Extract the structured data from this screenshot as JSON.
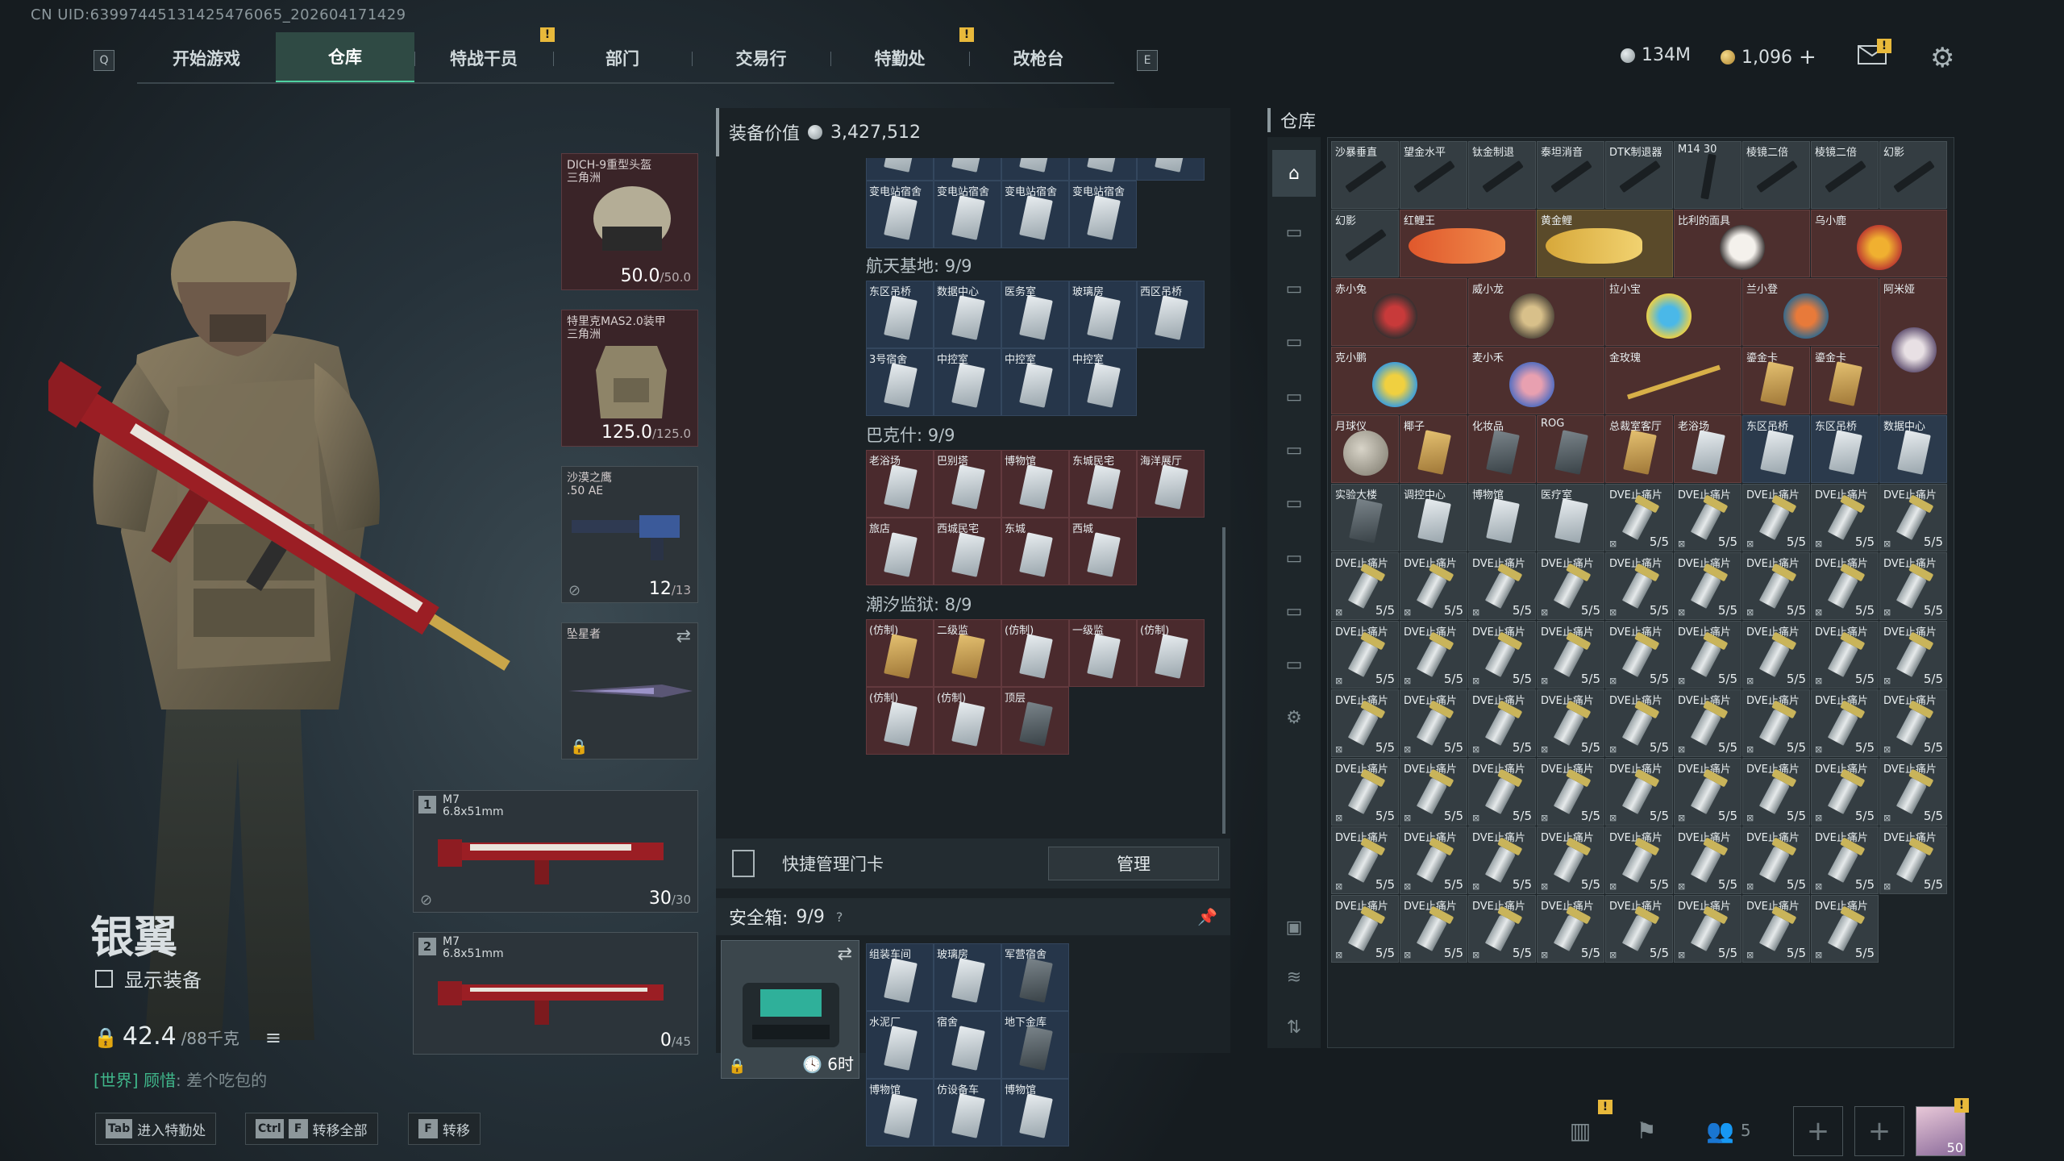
{
  "uid": "CN UID:63997445131425476065_202604171429",
  "nav": {
    "left_key": "Q",
    "right_key": "E",
    "tabs": [
      "开始游戏",
      "仓库",
      "特战干员",
      "部门",
      "交易行",
      "特勤处",
      "改枪台"
    ],
    "active": "仓库",
    "alert_mark": "!"
  },
  "currency": {
    "silver": "134M",
    "gold": "1,096",
    "plus": "+"
  },
  "character": {
    "name": "银翼",
    "show_equipment": "显示装备",
    "weight": "42.4",
    "weight_max": "/88千克",
    "chat_tag": "[世界]",
    "chat_user": "顾惜",
    "chat_msg": "差个吃包的"
  },
  "equipment": {
    "helmet": {
      "name": "DICH-9重型头盔",
      "sub": "三角洲",
      "dur": "50.0",
      "dur_max": "/50.0"
    },
    "armor": {
      "name": "特里克MAS2.0装甲",
      "sub": "三角洲",
      "dur": "125.0",
      "dur_max": "/125.0"
    },
    "pistol": {
      "name": "沙漠之鹰",
      "sub": ".50 AE",
      "ammo": "12",
      "ammo_max": "/13"
    },
    "melee": {
      "name": "坠星者"
    },
    "primary1": {
      "num": "1",
      "name": "M7",
      "caliber": "6.8x51mm",
      "ammo": "30",
      "ammo_max": "/30"
    },
    "primary2": {
      "num": "2",
      "name": "M7",
      "caliber": "6.8x51mm",
      "ammo": "0",
      "ammo_max": "/45"
    }
  },
  "middle": {
    "equip_value_label": "装备价值",
    "equip_value": "3,427,512",
    "sections": [
      {
        "title": "航天基地: 9/9",
        "items": [
          "东区吊桥",
          "数据中心",
          "医务室",
          "玻璃房",
          "西区吊桥",
          "3号宿舍",
          "中控室",
          "中控室",
          "中控室"
        ]
      },
      {
        "title": "巴克什: 9/9",
        "items": [
          "老浴场",
          "巴别塔",
          "博物馆",
          "东城民宅",
          "海洋展厅",
          "旅店",
          "西城民宅",
          "东城",
          "西城"
        ]
      },
      {
        "title": "潮汐监狱: 8/9",
        "items": [
          "(仿制)",
          "二级监",
          "(仿制)",
          "一级监",
          "(仿制)",
          "(仿制)",
          "(仿制)",
          "顶层"
        ]
      }
    ],
    "top_items": [
      "变电站宿舍",
      "变电站宿舍",
      "变电站宿舍",
      "变电站宿舍"
    ],
    "quick_manage": "快捷管理门卡",
    "manage_btn": "管理",
    "safe_label": "安全箱:",
    "safe_count": "9/9",
    "safe_help": "?",
    "safe_timer": "6时",
    "safe_items": [
      "组装车间",
      "玻璃房",
      "军营宿舍",
      "水泥厂",
      "宿舍",
      "地下金库",
      "博物馆",
      "仿设备车",
      "博物馆"
    ]
  },
  "stash": {
    "title": "仓库",
    "row1": [
      "沙暴垂直",
      "望金水平",
      "钛金制退",
      "泰坦消音",
      "DTK制退器",
      "M14 30",
      "棱镜二倍",
      "棱镜二倍",
      "幻影"
    ],
    "row2": [
      "幻影",
      "红鲤王",
      "黄金鲤",
      "比利的面具",
      "乌小鹿"
    ],
    "row3": [
      "赤小兔",
      "威小龙",
      "拉小宝",
      "兰小登",
      "阿米娅"
    ],
    "row4": [
      "克小鹏",
      "麦小禾",
      "金玫瑰",
      "鎏金卡",
      "鎏金卡"
    ],
    "row5": [
      "月球仪",
      "椰子",
      "化妆品",
      "ROG",
      "总裁室客厅",
      "老浴场",
      "东区吊桥",
      "东区吊桥",
      "数据中心"
    ],
    "row6": [
      "实验大楼",
      "调控中心",
      "博物馆",
      "医疗室"
    ],
    "ammo_label": "DVE止痛片",
    "ammo_count": "5/5"
  },
  "bottom": {
    "tab_key": "Tab",
    "tab_label": "进入特勤处",
    "ctrl_key": "Ctrl",
    "f_key": "F",
    "ctrl_label": "转移全部",
    "f_label": "转移",
    "friends": "5",
    "avatar_level": "50"
  },
  "colors": {
    "accent": "#4fd1a2",
    "alert": "#e8b93b",
    "red_slot": "#3a2428"
  }
}
